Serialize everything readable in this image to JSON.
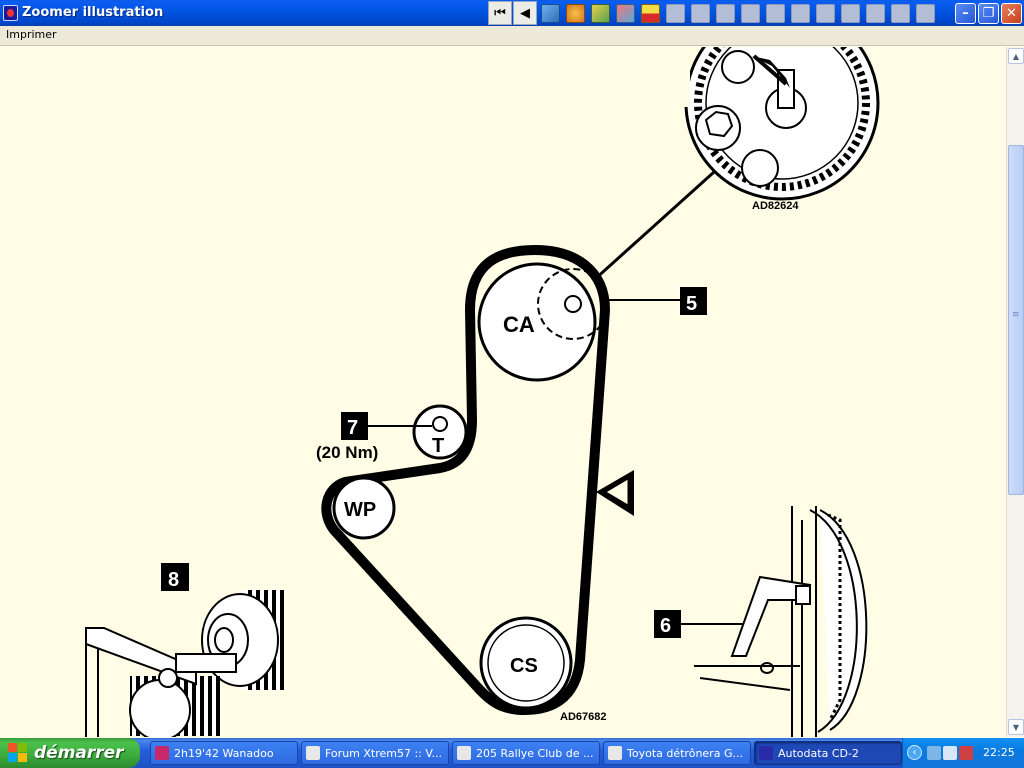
{
  "window": {
    "title": "Zoomer illustration",
    "toolbar_icons": [
      "first-page-icon",
      "previous-icon",
      "chart-icon",
      "gear-icon",
      "wrench-icon",
      "people-icon",
      "tape-icon",
      "tool-icon",
      "pen-icon",
      "box-icon",
      "printer-icon",
      "car-icon",
      "car2-icon",
      "car3-icon",
      "person-icon",
      "warning-icon",
      "truck-icon",
      "book-icon"
    ]
  },
  "menu": {
    "print_label": "Imprimer"
  },
  "diagram": {
    "ref_top": "AD82624",
    "ref_bottom": "AD67682",
    "pulley_ca": "CA",
    "pulley_cs": "CS",
    "pulley_wp": "WP",
    "pulley_t": "T",
    "callout_5": "5",
    "callout_6": "6",
    "callout_7": "7",
    "callout_8": "8",
    "torque": "(20 Nm)"
  },
  "taskbar": {
    "start_label": "démarrer",
    "tasks": [
      {
        "label": "2h19'42 Wanadoo",
        "icon_color": "#c8286a"
      },
      {
        "label": "Forum Xtrem57 :: V...",
        "icon_color": "#e8e8e8"
      },
      {
        "label": "205 Rallye Club de ...",
        "icon_color": "#e8e8e8"
      },
      {
        "label": "Toyota détrônera G...",
        "icon_color": "#e8e8e8"
      },
      {
        "label": "Autodata CD-2",
        "icon_color": "#2a2aa8"
      }
    ],
    "clock": "22:25"
  },
  "colors": {
    "page_background": "#fffde6",
    "xp_blue": "#0055e2",
    "start_green": "#3ca93c"
  }
}
